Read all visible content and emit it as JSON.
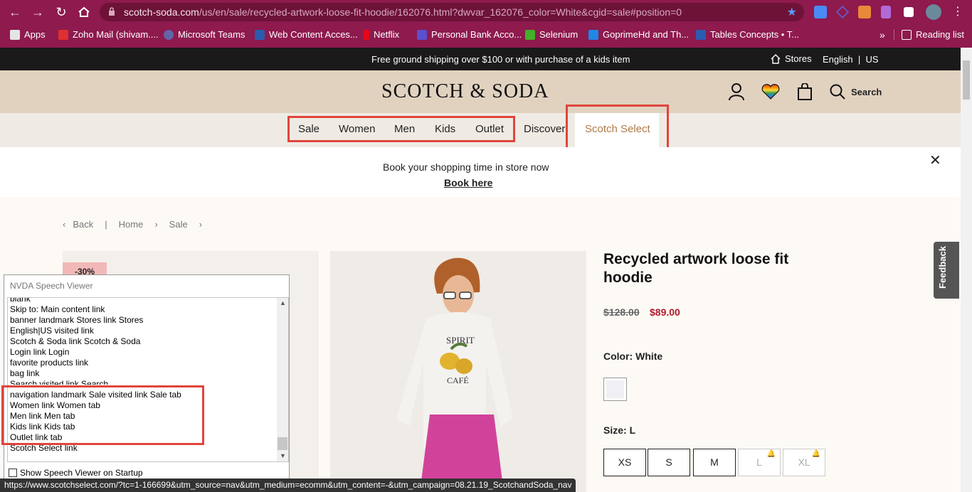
{
  "browser": {
    "url_host": "scotch-soda.com",
    "url_path": "/us/en/sale/recycled-artwork-loose-fit-hoodie/162076.html?dwvar_162076_color=White&cgid=sale#position=0",
    "bookmarks": [
      {
        "label": "Apps",
        "color": "#e5e5e5"
      },
      {
        "label": "Zoho Mail (shivam....",
        "color": "#e0302f"
      },
      {
        "label": "Microsoft Teams",
        "color": "#6264a7"
      },
      {
        "label": "Web Content Acces...",
        "color": "#2a5db0"
      },
      {
        "label": "Netflix",
        "color": "#e50914"
      },
      {
        "label": "Personal Bank Acco...",
        "color": "#5a4fcf"
      },
      {
        "label": "Selenium",
        "color": "#43b02a"
      },
      {
        "label": "GoprimeHd and Th...",
        "color": "#1e88e5"
      },
      {
        "label": "Tables Concepts • T...",
        "color": "#2a5db0"
      }
    ],
    "overflow": "»",
    "reading_list": "Reading list",
    "status_url": "https://www.scotchselect.com/?tc=1-166699&utm_source=nav&utm_medium=ecomm&utm_content=-&utm_campaign=08.21.19_ScotchandSoda_nav"
  },
  "site": {
    "promo": "Free ground shipping over $100 or with purchase of a kids item",
    "stores": "Stores",
    "lang_en": "English",
    "lang_sep": "|",
    "lang_us": "US",
    "logo": "SCOTCH & SODA",
    "search": "Search",
    "nav": [
      "Sale",
      "Women",
      "Men",
      "Kids",
      "Outlet",
      "Discover",
      "Scotch Select"
    ],
    "banner_text": "Book your shopping time in store now",
    "banner_link": "Book here",
    "breadcrumb": {
      "back": "Back",
      "home": "Home",
      "current": "Sale"
    },
    "discount_badge": "-30%",
    "feedback": "Feedback"
  },
  "product": {
    "title": "Recycled artwork loose fit hoodie",
    "old_price": "$128.00",
    "price": "$89.00",
    "color_label": "Color:",
    "color_value": "White",
    "size_label": "Size:",
    "size_value": "L",
    "sizes": [
      {
        "label": "XS",
        "available": true
      },
      {
        "label": "S",
        "available": true
      },
      {
        "label": "M",
        "available": true
      },
      {
        "label": "L",
        "available": false
      },
      {
        "label": "XL",
        "available": false
      }
    ],
    "print_text_1": "SPIRIT",
    "print_text_2": "CAFÉ"
  },
  "nvda": {
    "title": "NVDA Speech Viewer",
    "lines": [
      "blank",
      "Skip to: Main content  link",
      "banner landmark    Stores  link    Stores",
      "English|US  visited  link",
      "Scotch & Soda  link    Scotch & Soda",
      "Login  link    Login",
      "favorite products  link",
      "bag  link",
      "Search  visited  link    Search",
      "navigation landmark    Sale  visited  link    Sale  tab",
      "Women  link    Women  tab",
      "Men  link    Men  tab",
      "Kids  link    Kids  tab",
      "Outlet  link    tab",
      "Scotch Select  link"
    ],
    "checkbox_label": "Show Speech Viewer on Startup"
  }
}
